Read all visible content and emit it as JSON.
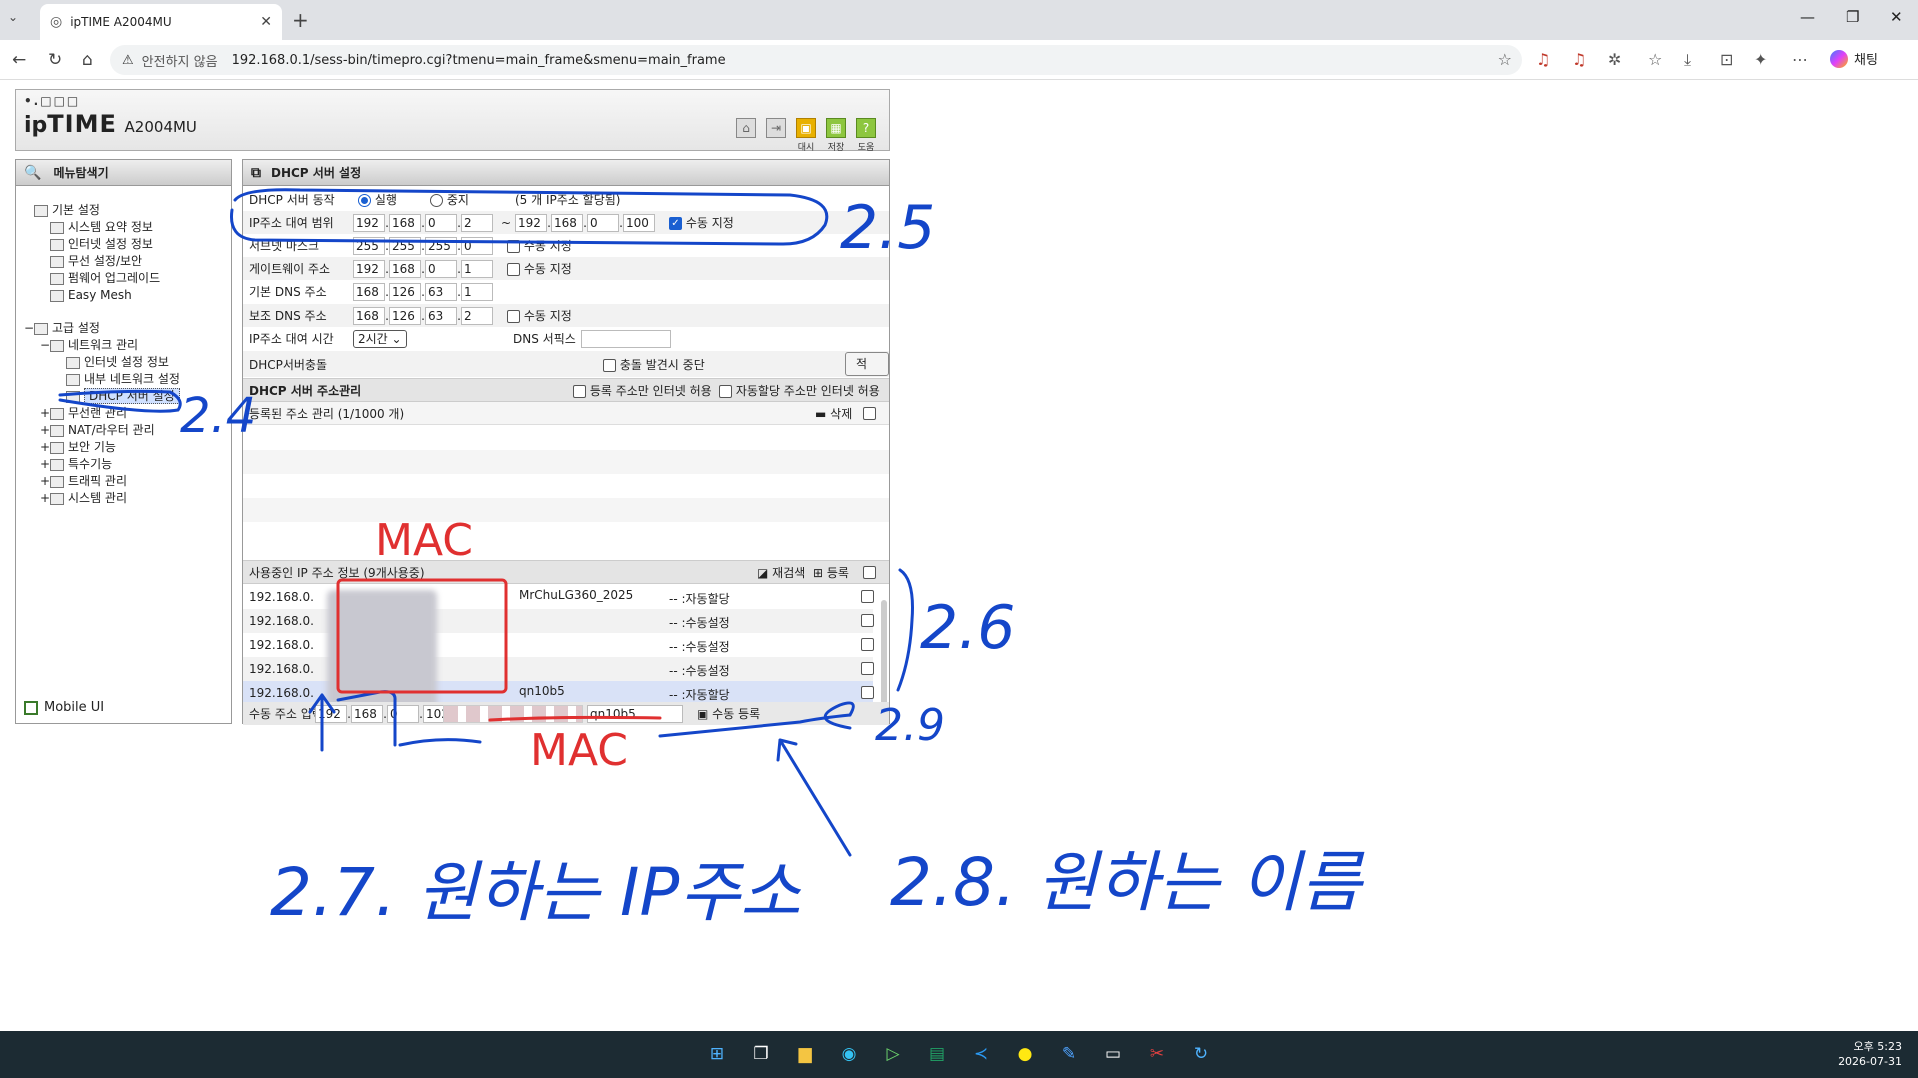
{
  "browser": {
    "tab_title": "ipTIME A2004MU",
    "insecure_label": "안전하지 않음",
    "url": "192.168.0.1/sess-bin/timepro.cgi?tmenu=main_frame&smenu=main_frame",
    "chat_label": "채팅"
  },
  "header": {
    "logo_dots": "•.□□□",
    "brand_a": "ip",
    "brand_b": "TIME",
    "model": "A2004MU",
    "icon_labels": [
      "",
      "",
      "",
      "대시",
      "저장",
      "도움"
    ]
  },
  "sidebar": {
    "title": "메뉴탐색기",
    "items": [
      {
        "label": "기본 설정",
        "level": 0,
        "ex": ""
      },
      {
        "label": "시스템 요약 정보",
        "level": 1
      },
      {
        "label": "인터넷 설정 정보",
        "level": 1
      },
      {
        "label": "무선 설정/보안",
        "level": 1
      },
      {
        "label": "펌웨어 업그레이드",
        "level": 1
      },
      {
        "label": "Easy Mesh",
        "level": 1
      },
      {
        "label": "고급 설정",
        "level": 0,
        "ex": "−"
      },
      {
        "label": "네트워크 관리",
        "level": 1,
        "ex": "−"
      },
      {
        "label": "인터넷 설정 정보",
        "level": 2
      },
      {
        "label": "내부 네트워크 설정",
        "level": 2
      },
      {
        "label": "DHCP 서버 설정",
        "level": 2,
        "selected": true
      },
      {
        "label": "무선랜 관리",
        "level": 1,
        "ex": "+"
      },
      {
        "label": "NAT/라우터 관리",
        "level": 1,
        "ex": "+"
      },
      {
        "label": "보안 기능",
        "level": 1,
        "ex": "+"
      },
      {
        "label": "특수기능",
        "level": 1,
        "ex": "+"
      },
      {
        "label": "트래픽 관리",
        "level": 1,
        "ex": "+"
      },
      {
        "label": "시스템 관리",
        "level": 1,
        "ex": "+"
      }
    ],
    "mobile": "Mobile UI"
  },
  "dhcp": {
    "title": "DHCP 서버 설정",
    "server_action_label": "DHCP 서버 동작",
    "run_label": "실행",
    "stop_label": "중지",
    "alloc_note": "(5 개 IP주소 할당됨)",
    "range_label": "IP주소 대여 범위",
    "range_start": [
      "192",
      "168",
      "0",
      "2"
    ],
    "range_tilde": "~",
    "range_end": [
      "192",
      "168",
      "0",
      "100"
    ],
    "manual_label": "수동 지정",
    "subnet_label": "서브넷 마스크",
    "subnet": [
      "255",
      "255",
      "255",
      "0"
    ],
    "gateway_label": "게이트웨이 주소",
    "gateway": [
      "192",
      "168",
      "0",
      "1"
    ],
    "dns1_label": "기본 DNS 주소",
    "dns1": [
      "168",
      "126",
      "63",
      "1"
    ],
    "dns2_label": "보조 DNS 주소",
    "dns2": [
      "168",
      "126",
      "63",
      "2"
    ],
    "lease_label": "IP주소 대여 시간",
    "lease_value": "2시간",
    "suffix_label": "DNS 서픽스",
    "conflict_label": "DHCP서버충돌",
    "conflict_stop": "충돌 발견시 중단",
    "apply": "적용",
    "addr_mgmt_label": "DHCP 서버 주소관리",
    "reg_only": "등록 주소만 인터넷 허용",
    "auto_only": "자동할당 주소만 인터넷 허용",
    "registered_label": "등록된 주소 관리 (1/1000 개)",
    "delete_label": "삭제",
    "inuse_label": "사용중인 IP 주소 정보",
    "inuse_count": "(9개사용중)",
    "rescan": "재검색",
    "register": "등록",
    "leases": [
      {
        "ip": "192.168.0.",
        "name": "MrChuLG360_2025",
        "type": "-- :자동할당"
      },
      {
        "ip": "192.168.0.",
        "name": "",
        "type": "-- :수동설정"
      },
      {
        "ip": "192.168.0.",
        "name": "",
        "type": "-- :수동설정"
      },
      {
        "ip": "192.168.0.",
        "name": "",
        "type": "-- :수동설정"
      },
      {
        "ip": "192.168.0.",
        "name": "qn10b5",
        "type": "-- :자동할당"
      }
    ],
    "manual_input_label": "수동 주소 입력",
    "manual_ip": [
      "192",
      "168",
      "0",
      "102"
    ],
    "manual_name": "qn10b5",
    "manual_register": "수동 등록"
  },
  "annotations": {
    "a25": "2.5",
    "a24": "2.4",
    "a26": "2.6",
    "a29": "2.9",
    "mac_top": "MAC",
    "mac_bottom": "MAC",
    "a27": "2.7. 원하는 IP주소",
    "a28": "2.8. 원하는 이름"
  },
  "taskbar": {
    "time": "오후 5:23",
    "date": "2026-07-31"
  }
}
